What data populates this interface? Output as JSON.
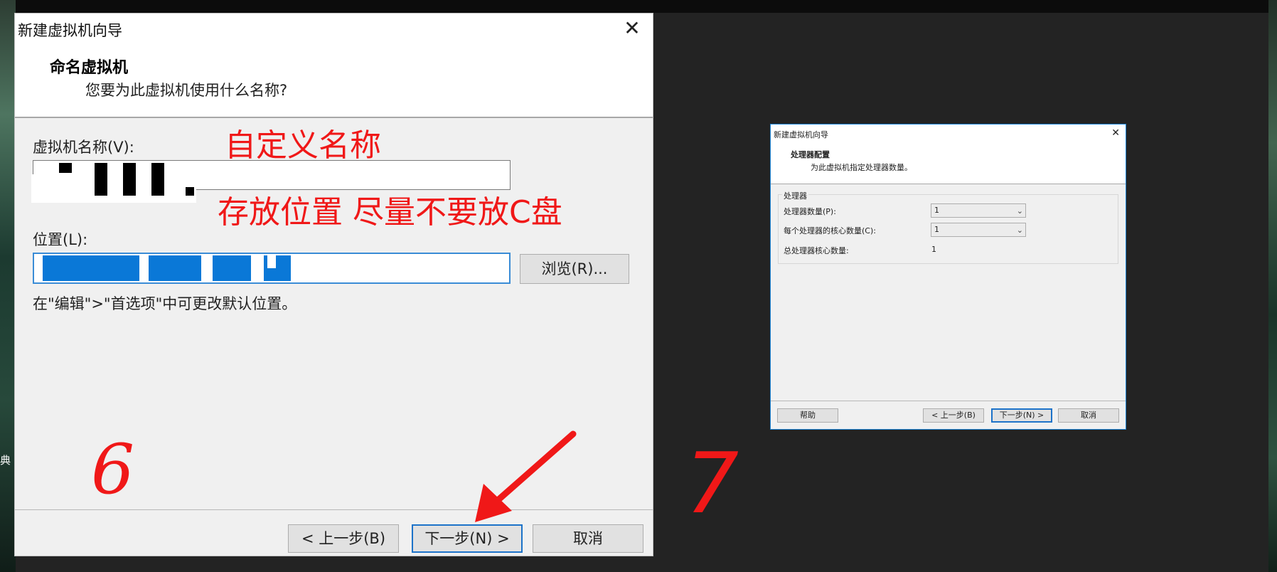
{
  "background": {
    "side_text": "典"
  },
  "dialog_name": {
    "title": "新建虚拟机向导",
    "close_glyph": "✕",
    "heading": "命名虚拟机",
    "subheading": "您要为此虚拟机使用什么名称?",
    "vm_name_label": "虚拟机名称(V):",
    "vm_name_value": "",
    "location_label": "位置(L):",
    "location_value": "",
    "browse_label": "浏览(R)...",
    "hint": "在\"编辑\">\"首选项\"中可更改默认位置。",
    "back_label": "< 上一步(B)",
    "next_label": "下一步(N) >",
    "cancel_label": "取消"
  },
  "annotations": {
    "name_note": "自定义名称",
    "location_note": "存放位置 尽量不要放C盘",
    "step_6": "6",
    "step_7": "7",
    "accent": "#f01818"
  },
  "dialog_processor": {
    "title": "新建虚拟机向导",
    "close_glyph": "✕",
    "heading": "处理器配置",
    "subheading": "为此虚拟机指定处理器数量。",
    "group_label": "处理器",
    "count_label": "处理器数量(P):",
    "count_value": "1",
    "cores_label": "每个处理器的核心数量(C):",
    "cores_value": "1",
    "total_label": "总处理器核心数量:",
    "total_value": "1",
    "help_label": "帮助",
    "back_label": "< 上一步(B)",
    "next_label": "下一步(N) >",
    "cancel_label": "取消"
  }
}
